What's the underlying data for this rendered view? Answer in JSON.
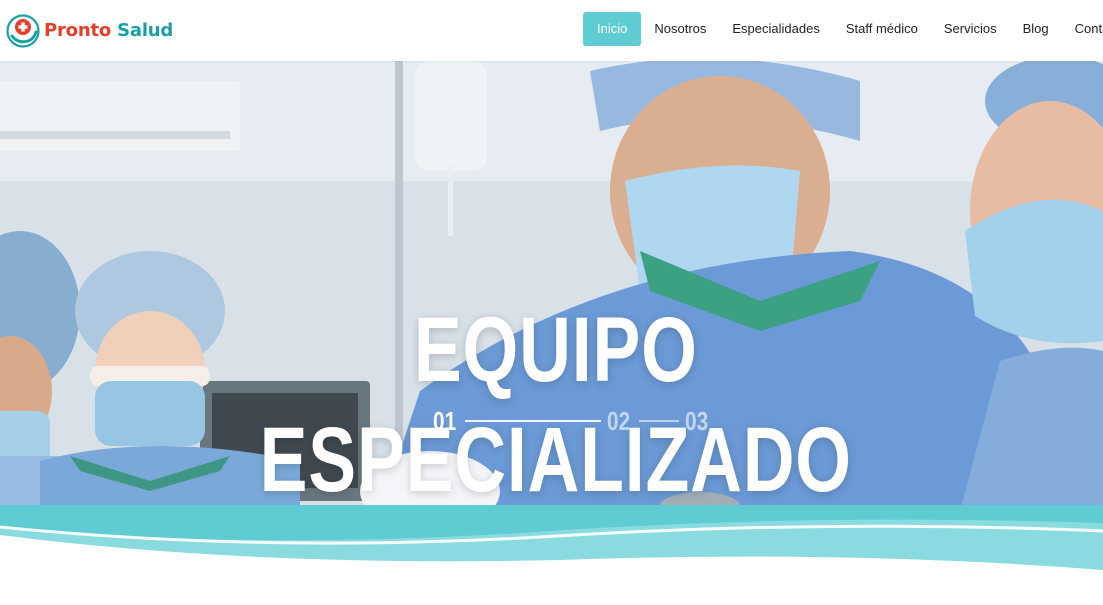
{
  "brand": {
    "name_part1": "Pronto",
    "name_part2": "Salud",
    "colors": {
      "red": "#e2402b",
      "teal": "#1b9fa6"
    },
    "logo_icon": "medical-cross-hand-icon"
  },
  "nav": {
    "items": [
      {
        "label": "Inicio",
        "active": true
      },
      {
        "label": "Nosotros",
        "active": false
      },
      {
        "label": "Especialidades",
        "active": false
      },
      {
        "label": "Staff médico",
        "active": false
      },
      {
        "label": "Servicios",
        "active": false
      },
      {
        "label": "Blog",
        "active": false
      },
      {
        "label": "Conta",
        "active": false
      }
    ],
    "active_color": "#5fcbd2"
  },
  "hero": {
    "title": "EQUIPO ESPECIALIZADO",
    "slides": [
      "01",
      "02",
      "03"
    ],
    "active_slide": "01"
  },
  "theme": {
    "wave_colors": [
      "#5fcbd2",
      "#8adbe0"
    ]
  }
}
